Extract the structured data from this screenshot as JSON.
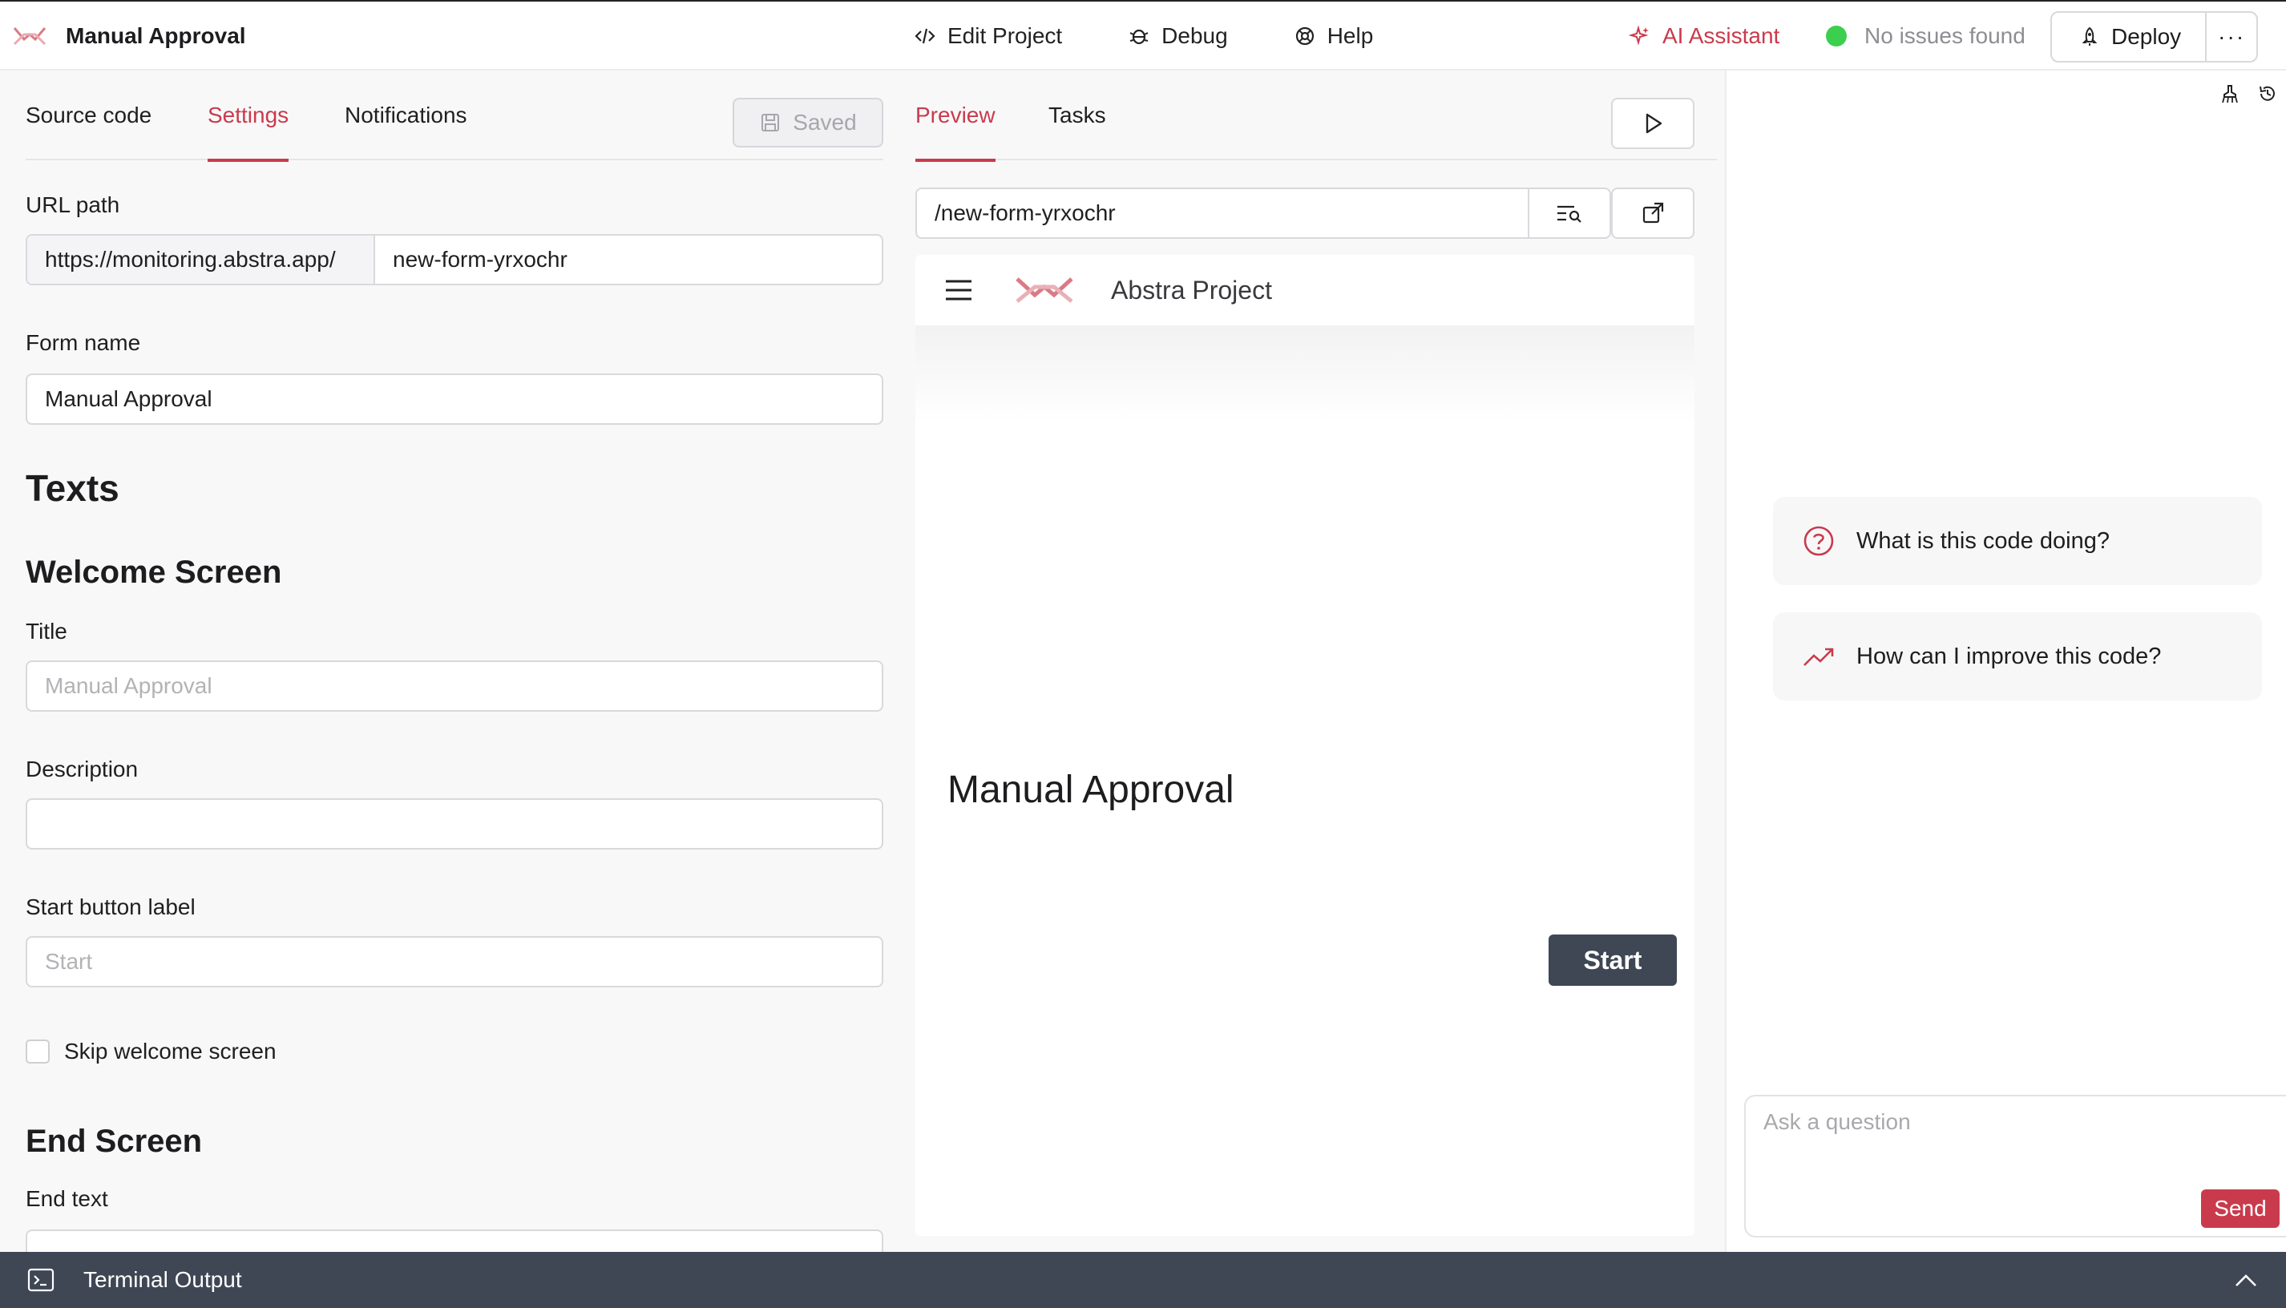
{
  "header": {
    "title": "Manual Approval",
    "nav": [
      {
        "label": "Edit Project",
        "icon": "code-icon"
      },
      {
        "label": "Debug",
        "icon": "bug-icon"
      },
      {
        "label": "Help",
        "icon": "lifebuoy-icon"
      }
    ],
    "ai_assistant": "AI Assistant",
    "status_text": "No issues found",
    "status_color": "#3ccf4e",
    "deploy_label": "Deploy",
    "more_label": "···",
    "accent_color": "#c93b4c"
  },
  "left": {
    "tabs": [
      "Source code",
      "Settings",
      "Notifications"
    ],
    "active_tab": "Settings",
    "saved_label": "Saved",
    "url_path_label": "URL path",
    "url_prefix": "https://monitoring.abstra.app/",
    "url_suffix": "new-form-yrxochr",
    "form_name_label": "Form name",
    "form_name_value": "Manual Approval",
    "texts_heading": "Texts",
    "welcome_heading": "Welcome Screen",
    "title_label": "Title",
    "title_placeholder": "Manual Approval",
    "description_label": "Description",
    "description_value": "",
    "start_label_label": "Start button label",
    "start_label_placeholder": "Start",
    "skip_welcome_label": "Skip welcome screen",
    "skip_welcome_checked": false,
    "end_heading": "End Screen",
    "end_text_label": "End text"
  },
  "preview": {
    "tabs": [
      "Preview",
      "Tasks"
    ],
    "active_tab": "Preview",
    "path": "/new-form-yrxochr",
    "app_brand": "Abstra Project",
    "form_title": "Manual Approval",
    "start_button": "Start"
  },
  "ai": {
    "suggestions": [
      {
        "label": "What is this code doing?",
        "icon": "question-circle-icon"
      },
      {
        "label": "How can I improve this code?",
        "icon": "trending-up-icon"
      }
    ],
    "ask_placeholder": "Ask a question",
    "send_label": "Send"
  },
  "terminal": {
    "label": "Terminal Output"
  }
}
